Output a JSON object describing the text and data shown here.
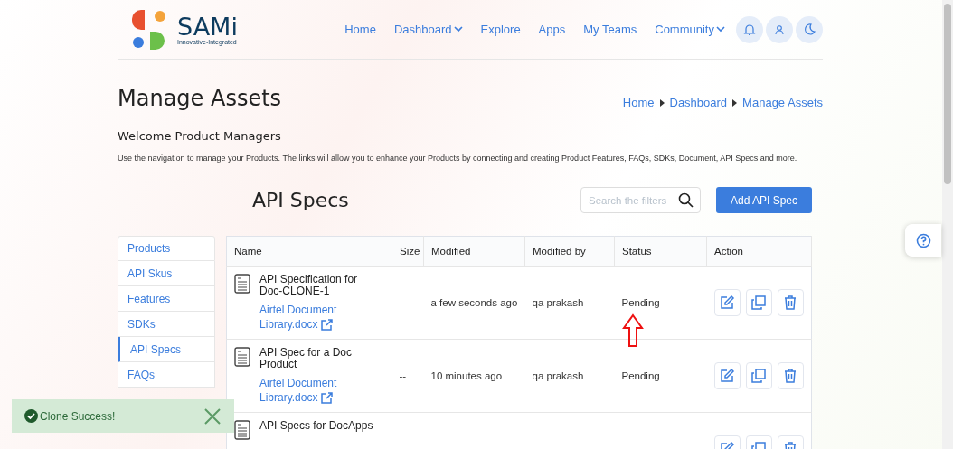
{
  "header": {
    "logo": {
      "name": "SAMi",
      "tagline": "Innovative-Integrated"
    },
    "nav": [
      {
        "label": "Home",
        "dropdown": false
      },
      {
        "label": "Dashboard",
        "dropdown": true
      },
      {
        "label": "Explore",
        "dropdown": false
      },
      {
        "label": "Apps",
        "dropdown": false
      },
      {
        "label": "My Teams",
        "dropdown": false
      },
      {
        "label": "Community",
        "dropdown": true
      }
    ]
  },
  "page": {
    "title": "Manage Assets",
    "breadcrumb": [
      "Home",
      "Dashboard",
      "Manage Assets"
    ],
    "welcome": "Welcome Product Managers",
    "description": "Use the navigation to manage your Products. The links will allow you to enhance your Products by connecting and creating Product Features, FAQs, SDKs, Document, API Specs and more."
  },
  "sidebar": {
    "items": [
      {
        "label": "Products",
        "selected": false
      },
      {
        "label": "API Skus",
        "selected": false
      },
      {
        "label": "Features",
        "selected": false
      },
      {
        "label": "SDKs",
        "selected": false
      },
      {
        "label": "API Specs",
        "selected": true
      },
      {
        "label": "FAQs",
        "selected": false
      }
    ]
  },
  "panel": {
    "title": "API Specs",
    "search": {
      "placeholder": "Search the filters"
    },
    "add_button": "Add API Spec"
  },
  "table": {
    "columns": [
      "Name",
      "Size",
      "Modified",
      "Modified by",
      "Status",
      "Action"
    ],
    "rows": [
      {
        "name": "API Specification for Doc-CLONE-1",
        "file": "Airtel Document Library.docx",
        "size": "--",
        "modified": "a few seconds ago",
        "modified_by": "qa prakash",
        "status": "Pending",
        "annotated": true
      },
      {
        "name": "API Spec for a Doc Product",
        "file": "Airtel Document Library.docx",
        "size": "--",
        "modified": "10 minutes ago",
        "modified_by": "qa prakash",
        "status": "Pending",
        "annotated": false
      },
      {
        "name": "API Specs for DocApps"
      }
    ]
  },
  "toast": {
    "message": "Clone Success!"
  }
}
